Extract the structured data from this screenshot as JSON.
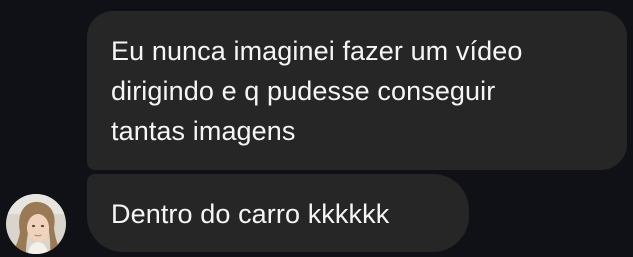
{
  "conversation": {
    "messages": [
      {
        "lines": [
          "Eu nunca imaginei fazer um vídeo",
          "dirigindo e q pudesse conseguir",
          "tantas imagens"
        ]
      },
      {
        "text": "Dentro do carro kkkkkk"
      }
    ],
    "sender_avatar": {
      "icon": "profile-photo"
    }
  },
  "colors": {
    "background": "#101116",
    "bubble": "#262626",
    "text": "#f5f5f5"
  }
}
